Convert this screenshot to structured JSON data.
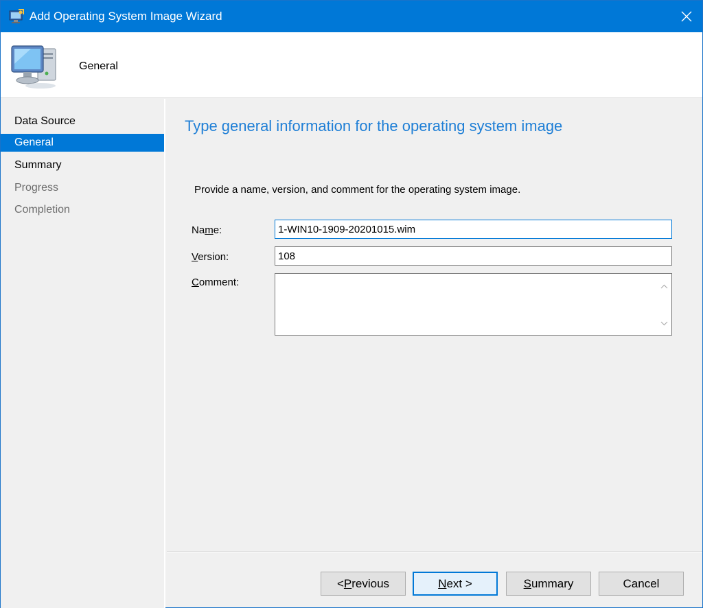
{
  "window": {
    "title": "Add Operating System Image Wizard",
    "accent_color": "#0078d7"
  },
  "header": {
    "title": "General",
    "icon": "computer-icon"
  },
  "nav": {
    "items": [
      {
        "label": "Data Source",
        "state": "normal"
      },
      {
        "label": "General",
        "state": "selected"
      },
      {
        "label": "Summary",
        "state": "normal"
      },
      {
        "label": "Progress",
        "state": "disabled"
      },
      {
        "label": "Completion",
        "state": "disabled"
      }
    ]
  },
  "main": {
    "heading": "Type general information for the operating system image",
    "description": "Provide a name, version, and comment for the operating system image.",
    "fields": {
      "name": {
        "label_pre": "Na",
        "label_mnemonic": "m",
        "label_post": "e:",
        "value": "1-WIN10-1909-20201015.wim"
      },
      "version": {
        "label_pre": "",
        "label_mnemonic": "V",
        "label_post": "ersion:",
        "value": "108"
      },
      "comment": {
        "label_pre": "",
        "label_mnemonic": "C",
        "label_post": "omment:",
        "value": ""
      }
    }
  },
  "buttons": {
    "previous": {
      "pre": "< ",
      "mnemonic": "P",
      "post": "revious"
    },
    "next": {
      "pre": "",
      "mnemonic": "N",
      "post": "ext >"
    },
    "summary": {
      "pre": "",
      "mnemonic": "S",
      "post": "ummary"
    },
    "cancel": {
      "label": "Cancel"
    }
  }
}
